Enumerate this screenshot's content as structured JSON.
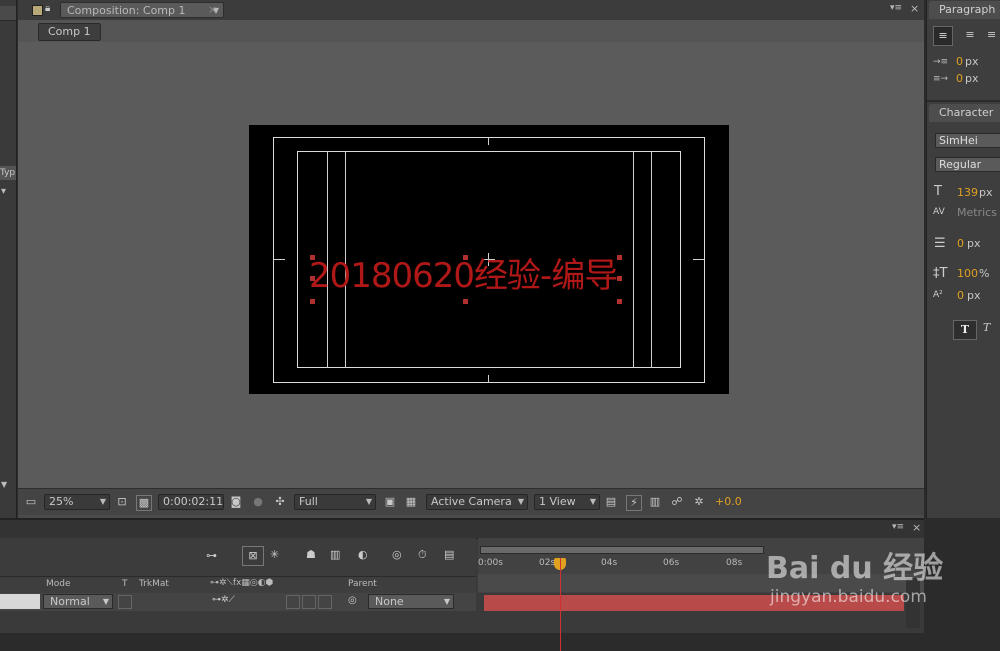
{
  "composition": {
    "tab_title": "Composition: Comp 1",
    "flow_button": "Comp 1",
    "comp_text": "20180620经验-编导"
  },
  "viewer_toolbar": {
    "zoom": "25%",
    "timecode": "0:00:02:11",
    "resolution": "Full",
    "camera": "Active Camera",
    "views": "1 View",
    "exposure": "+0.0"
  },
  "left_panel": {
    "tab_label": "Typ"
  },
  "paragraph_panel": {
    "title": "Paragraph",
    "indent_left": "0",
    "indent_first": "0",
    "unit": "px"
  },
  "character_panel": {
    "title": "Character",
    "font": "SimHei",
    "style": "Regular",
    "font_size": "139",
    "kerning": "Metrics",
    "leading": "0",
    "vertical_scale": "100",
    "vertical_scale_unit": "%",
    "baseline_shift": "0",
    "unit": "px",
    "faux_bold_glyph": "T",
    "faux_italic_glyph": "T"
  },
  "timeline": {
    "columns": {
      "mode": "Mode",
      "t": "T",
      "trkmat": "TrkMat",
      "parent": "Parent"
    },
    "layer": {
      "mode": "Normal",
      "parent": "None"
    },
    "ruler": [
      "0:00s",
      "02s",
      "04s",
      "06s",
      "08s"
    ]
  },
  "watermark": {
    "brand": "Bai du 经验",
    "url": "jingyan.baidu.com"
  },
  "colors": {
    "accent": "#e0a020",
    "comp_text": "#b01818",
    "layer_bar": "#b84a4a"
  }
}
